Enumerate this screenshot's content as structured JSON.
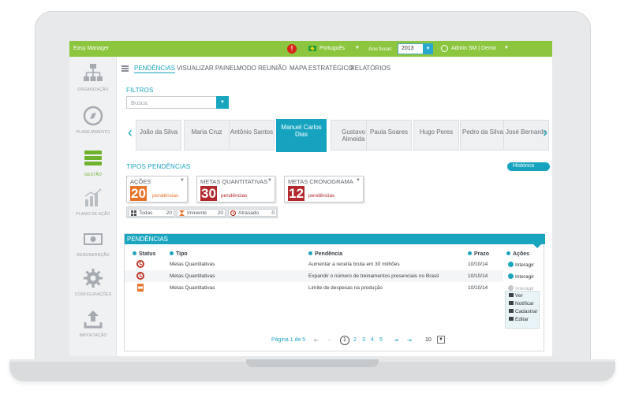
{
  "app": {
    "title": "Easy Manager"
  },
  "topbar": {
    "language": "Português",
    "fiscal_year_label": "Ano fiscal:",
    "fiscal_year_value": "2013",
    "user": "Admin SM | Demo"
  },
  "sidebar": {
    "items": [
      {
        "label": "ORGANIZAÇÃO",
        "icon": "org-chart-icon"
      },
      {
        "label": "PLANEJAMENTO",
        "icon": "compass-icon"
      },
      {
        "label": "GESTÃO",
        "icon": "layers-icon",
        "active": true
      },
      {
        "label": "PLANO DE AÇÃO",
        "icon": "bar-chart-icon"
      },
      {
        "label": "REMUNERAÇÃO",
        "icon": "money-icon"
      },
      {
        "label": "CONFIGURAÇÕES",
        "icon": "gear-icon"
      },
      {
        "label": "IMPORTAÇÃO",
        "icon": "upload-icon"
      }
    ]
  },
  "tabs": [
    "PENDÊNCIAS",
    "VISUALIZAR PAINEL",
    "MODO REUNIÃO",
    "MAPA ESTRATÉGICO",
    "RELATÓRIOS"
  ],
  "filters": {
    "title": "FILTROS",
    "search_placeholder": "Busca"
  },
  "people": [
    "João da Silva",
    "Maria Cruz",
    "Antônio Santos",
    "Manuel Carlos Dias",
    "Gustavo Almeida",
    "Paula Soares",
    "Hugo Peres",
    "Pedro da Silva",
    "José Bernardo"
  ],
  "pending_types": {
    "title": "TIPOS PENDÊNCIAS",
    "history_button": "Histórico",
    "boxes": [
      {
        "title": "AÇÕES",
        "count": "20",
        "suffix": "pendências",
        "color": "#e8732a"
      },
      {
        "title": "METAS QUANTITATIVAS",
        "count": "30",
        "suffix": "pendências",
        "color": "#b3282d"
      },
      {
        "title": "METAS CRONOGRAMA",
        "count": "12",
        "suffix": "pendências",
        "color": "#b3282d"
      }
    ],
    "filter_buttons": [
      {
        "label": "Todas",
        "count": "20"
      },
      {
        "label": "Iminente",
        "count": "20"
      },
      {
        "label": "Atrasado",
        "count": "0"
      }
    ]
  },
  "panel": {
    "title": "PENDÊNCIAS",
    "headers": {
      "status": "Status",
      "tipo": "Tipo",
      "pendencia": "Pendência",
      "prazo": "Prazo",
      "acoes": "Ações"
    },
    "rows": [
      {
        "status": "late",
        "tipo": "Metas Quantitativas",
        "pendencia": "Aumentar a receita bruta em 30 milhões",
        "prazo": "10/10/14",
        "acao": "Interagir"
      },
      {
        "status": "late",
        "tipo": "Metas Quantitativas",
        "pendencia": "Expandir o número de treinamentos presenciais no Brasil",
        "prazo": "10/10/14",
        "acao": "Interagir"
      },
      {
        "status": "imminent",
        "tipo": "Metas Quantitativas",
        "pendencia": "Limite de despesas na produção",
        "prazo": "10/10/14",
        "acao": "Interagir"
      }
    ],
    "menu": [
      "Ver",
      "Notificar",
      "Cadastrar",
      "Editar"
    ],
    "pager": {
      "label": "Página 1 de 5",
      "first": "⇤",
      "prev": "←",
      "pages": [
        "1",
        "2",
        "3",
        "4",
        "5"
      ],
      "next": "⇥",
      "last": "⇥",
      "page_size": "10"
    }
  }
}
